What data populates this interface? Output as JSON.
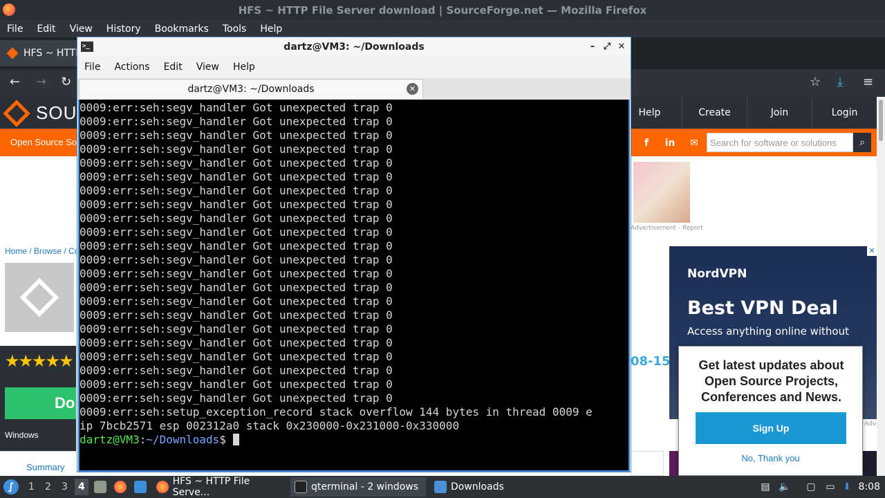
{
  "firefox": {
    "window_title": "HFS ~ HTTP File Server download | SourceForge.net — Mozilla Firefox",
    "menu": [
      "File",
      "Edit",
      "View",
      "History",
      "Bookmarks",
      "Tools",
      "Help"
    ],
    "tab_title": "HFS ~ HTTP"
  },
  "sourceforge": {
    "logo_text": "SOUR",
    "nav": [
      "Help",
      "Create",
      "Join",
      "Login"
    ],
    "tagline": "Open Source So",
    "search_placeholder": "Search for software or solutions",
    "ad_caption": "Advertisement - Report",
    "breadcrumb": "Home / Browse / Co",
    "stars": "★★★★★",
    "download_label": "Do",
    "os_label": "Windows",
    "summary_tab": "Summary",
    "date_fragment": "08-15",
    "nordvpn": {
      "logo": "NordVPN",
      "title": "Best VPN Deal",
      "subtitle": "Access anything online without"
    },
    "side_caption": "Advertisement",
    "newsletter": {
      "title": "Get latest updates about Open Source Projects, Conferences and News.",
      "signup_label": "Sign Up",
      "decline_label": "No, Thank you"
    }
  },
  "qterminal": {
    "window_title": "dartz@VM3: ~/Downloads",
    "menu": [
      "File",
      "Actions",
      "Edit",
      "View",
      "Help"
    ],
    "tab_title": "dartz@VM3: ~/Downloads",
    "output_lines": [
      "0009:err:seh:segv_handler Got unexpected trap 0",
      "0009:err:seh:segv_handler Got unexpected trap 0",
      "0009:err:seh:segv_handler Got unexpected trap 0",
      "0009:err:seh:segv_handler Got unexpected trap 0",
      "0009:err:seh:segv_handler Got unexpected trap 0",
      "0009:err:seh:segv_handler Got unexpected trap 0",
      "0009:err:seh:segv_handler Got unexpected trap 0",
      "0009:err:seh:segv_handler Got unexpected trap 0",
      "0009:err:seh:segv_handler Got unexpected trap 0",
      "0009:err:seh:segv_handler Got unexpected trap 0",
      "0009:err:seh:segv_handler Got unexpected trap 0",
      "0009:err:seh:segv_handler Got unexpected trap 0",
      "0009:err:seh:segv_handler Got unexpected trap 0",
      "0009:err:seh:segv_handler Got unexpected trap 0",
      "0009:err:seh:segv_handler Got unexpected trap 0",
      "0009:err:seh:segv_handler Got unexpected trap 0",
      "0009:err:seh:segv_handler Got unexpected trap 0",
      "0009:err:seh:segv_handler Got unexpected trap 0",
      "0009:err:seh:segv_handler Got unexpected trap 0",
      "0009:err:seh:segv_handler Got unexpected trap 0",
      "0009:err:seh:segv_handler Got unexpected trap 0",
      "0009:err:seh:segv_handler Got unexpected trap 0",
      "0009:err:seh:setup_exception_record stack overflow 144 bytes in thread 0009 e",
      "ip 7bcb2571 esp 002312a0 stack 0x230000-0x231000-0x330000"
    ],
    "prompt_user": "dartz@VM3",
    "prompt_sep": ":",
    "prompt_path": "~/Downloads",
    "prompt_symbol": "$"
  },
  "taskbar": {
    "workspaces": [
      "1",
      "2",
      "3",
      "4"
    ],
    "active_workspace": "4",
    "tasks": [
      {
        "label": "HFS ~ HTTP File Serve...",
        "icon": "firefox-icon"
      },
      {
        "label": "qterminal - 2 windows",
        "icon": "terminal-icon"
      },
      {
        "label": "Downloads",
        "icon": "folder-icon"
      }
    ],
    "clock": "8:08"
  },
  "colors": {
    "sf_orange": "#ff6600",
    "terminal_bg": "#000000",
    "prompt_user": "#55e855",
    "prompt_path": "#7aa6ff"
  }
}
